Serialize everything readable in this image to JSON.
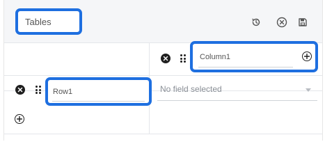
{
  "header": {
    "title": "Tables",
    "icons": [
      "history-icon",
      "clear-circle-icon",
      "save-icon"
    ]
  },
  "table": {
    "column_header": {
      "label": "Column1"
    },
    "rows": [
      {
        "label": "Row1",
        "field_value": "No field selected"
      }
    ]
  },
  "colors": {
    "highlight": "#1e6fe0",
    "icon_dark": "#1f1f1f",
    "placeholder": "#8a8f96"
  }
}
